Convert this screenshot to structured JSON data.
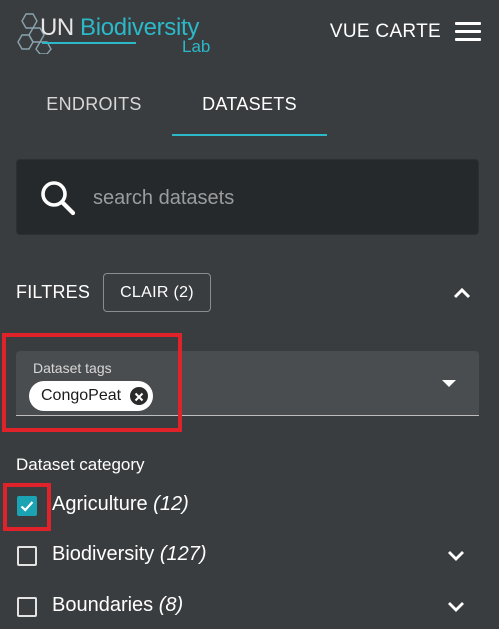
{
  "header": {
    "logo_un": "UN",
    "logo_bio": "Biodiversity",
    "logo_lab": "Lab",
    "view_map_label": "VUE CARTE"
  },
  "tabs": [
    {
      "label": "ENDROITS",
      "active": false
    },
    {
      "label": "DATASETS",
      "active": true
    }
  ],
  "search": {
    "placeholder": "search datasets",
    "value": ""
  },
  "filters": {
    "label": "FILTRES",
    "clear_label": "CLAIR (2)"
  },
  "tags": {
    "label": "Dataset tags",
    "selected": [
      "CongoPeat"
    ]
  },
  "category": {
    "title": "Dataset category",
    "items": [
      {
        "label": "Agriculture",
        "count": "(12)",
        "checked": true,
        "expandable": false
      },
      {
        "label": "Biodiversity",
        "count": "(127)",
        "checked": false,
        "expandable": true
      },
      {
        "label": "Boundaries",
        "count": "(8)",
        "checked": false,
        "expandable": true
      }
    ]
  },
  "colors": {
    "background": "#3a3d40",
    "accent": "#2bb8c8",
    "highlight": "#e0222a",
    "checkbox": "#1ba3b3"
  },
  "icons": {
    "logo": "hexagon-logo-icon",
    "menu": "hamburger-menu-icon",
    "search": "search-icon",
    "collapse": "chevron-up-icon",
    "chip_remove": "close-circle-icon",
    "dropdown": "caret-down-icon",
    "expand": "chevron-down-icon"
  }
}
